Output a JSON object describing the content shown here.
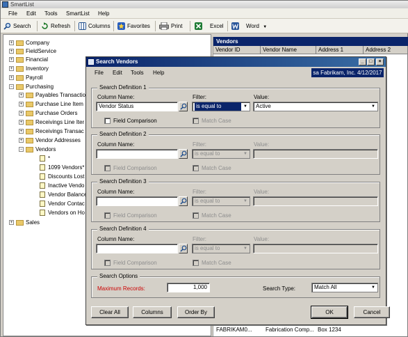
{
  "app": {
    "title": "SmartList"
  },
  "menu": [
    "File",
    "Edit",
    "Tools",
    "SmartList",
    "Help"
  ],
  "toolbar": {
    "search": "Search",
    "refresh": "Refresh",
    "columns": "Columns",
    "favorites": "Favorites",
    "print": "Print",
    "excel": "Excel",
    "word": "Word"
  },
  "tree": {
    "top": [
      "Company",
      "FieldService",
      "Financial",
      "Inventory",
      "Payroll",
      "Purchasing"
    ],
    "purchasing_children": [
      "Payables Transactio",
      "Purchase Line Item",
      "Purchase Orders",
      "Receivings Line Iter",
      "Receivings Transac",
      "Vendor Addresses",
      "Vendors"
    ],
    "vendors_children": [
      "*",
      "1099 Vendors*",
      "Discounts Lost",
      "Inactive Vendo",
      "Vendor Balance",
      "Vendor Contac",
      "Vendors on Ho"
    ],
    "after": [
      "Sales"
    ]
  },
  "grid": {
    "title": "Vendors",
    "columns": [
      "Vendor ID",
      "Vendor Name",
      "Address 1",
      "Address 2"
    ],
    "bottom_row": [
      "FABRIKAM0...",
      "Fabrication Comp...",
      "Box 1234"
    ]
  },
  "dialog": {
    "title": "Search Vendors",
    "menu": [
      "File",
      "Edit",
      "Tools",
      "Help"
    ],
    "user": "sa  Fabrikam, Inc.  4/12/2017",
    "labels": {
      "column_name": "Column Name:",
      "filter": "Filter:",
      "value": "Value:",
      "field_comparison": "Field Comparison",
      "match_case": "Match Case"
    },
    "defs": [
      {
        "title": "Search Definition 1",
        "column": "Vendor Status",
        "filter": "is equal to",
        "value": "Active"
      },
      {
        "title": "Search Definition 2",
        "column": "",
        "filter": "is equal to",
        "value": ""
      },
      {
        "title": "Search Definition 3",
        "column": "",
        "filter": "is equal to",
        "value": ""
      },
      {
        "title": "Search Definition 4",
        "column": "",
        "filter": "is equal to",
        "value": ""
      }
    ],
    "options": {
      "title": "Search Options",
      "max_label": "Maximum Records:",
      "max_value": "1,000",
      "type_label": "Search Type:",
      "type_value": "Match All"
    },
    "buttons": {
      "clear_all": "Clear All",
      "columns": "Columns",
      "order_by": "Order By",
      "ok": "OK",
      "cancel": "Cancel"
    }
  },
  "colors": {
    "title_blue": "#0a246a",
    "required_red": "#cc0000"
  }
}
